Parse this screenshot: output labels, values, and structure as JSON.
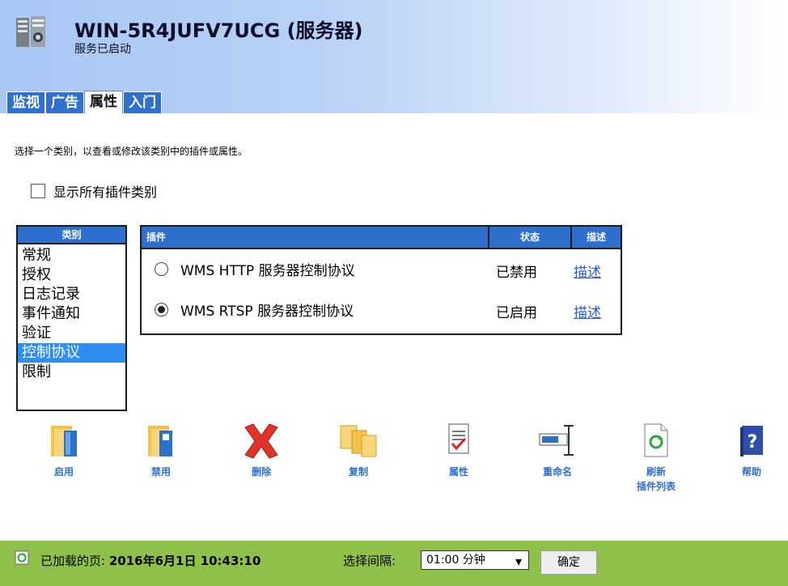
{
  "header": {
    "server_name": "WIN-5R4JUFV7UCG",
    "server_suffix": "(服务器)",
    "status": "服务已启动"
  },
  "tabs": [
    {
      "label": "监视",
      "active": false
    },
    {
      "label": "广告",
      "active": false
    },
    {
      "label": "属性",
      "active": true
    },
    {
      "label": "入门",
      "active": false
    }
  ],
  "instruction": "选择一个类别，以查看或修改该类别中的插件或属性。",
  "show_all_checkbox": {
    "label": "显示所有插件类别",
    "checked": false
  },
  "categories": {
    "header": "类别",
    "items": [
      "常规",
      "授权",
      "日志记录",
      "事件通知",
      "验证",
      "控制协议",
      "限制"
    ],
    "selected": "控制协议"
  },
  "plugins": {
    "columns": [
      "插件",
      "状态",
      "描述"
    ],
    "rows": [
      {
        "name": "WMS HTTP 服务器控制协议",
        "status": "已禁用",
        "desc": "描述",
        "selected": false
      },
      {
        "name": "WMS RTSP 服务器控制协议",
        "status": "已启用",
        "desc": "描述",
        "selected": true
      }
    ]
  },
  "toolbar": {
    "enable": "启用",
    "disable": "禁用",
    "delete": "删除",
    "copy": "复制",
    "properties": "属性",
    "rename": "重命名",
    "refresh_line1": "刷新",
    "refresh_line2": "插件列表",
    "help": "帮助"
  },
  "footer": {
    "loaded_label": "已加载的页:",
    "loaded_time": "2016年6月1日 10:43:10",
    "interval_label": "选择间隔:",
    "interval_value": "01:00 分钟",
    "ok_label": "确定"
  },
  "colors": {
    "accent_blue": "#2f6fce",
    "selection_blue": "#2f8ff0",
    "footer_green": "#8fc14a",
    "link_blue": "#2a5ad6"
  }
}
